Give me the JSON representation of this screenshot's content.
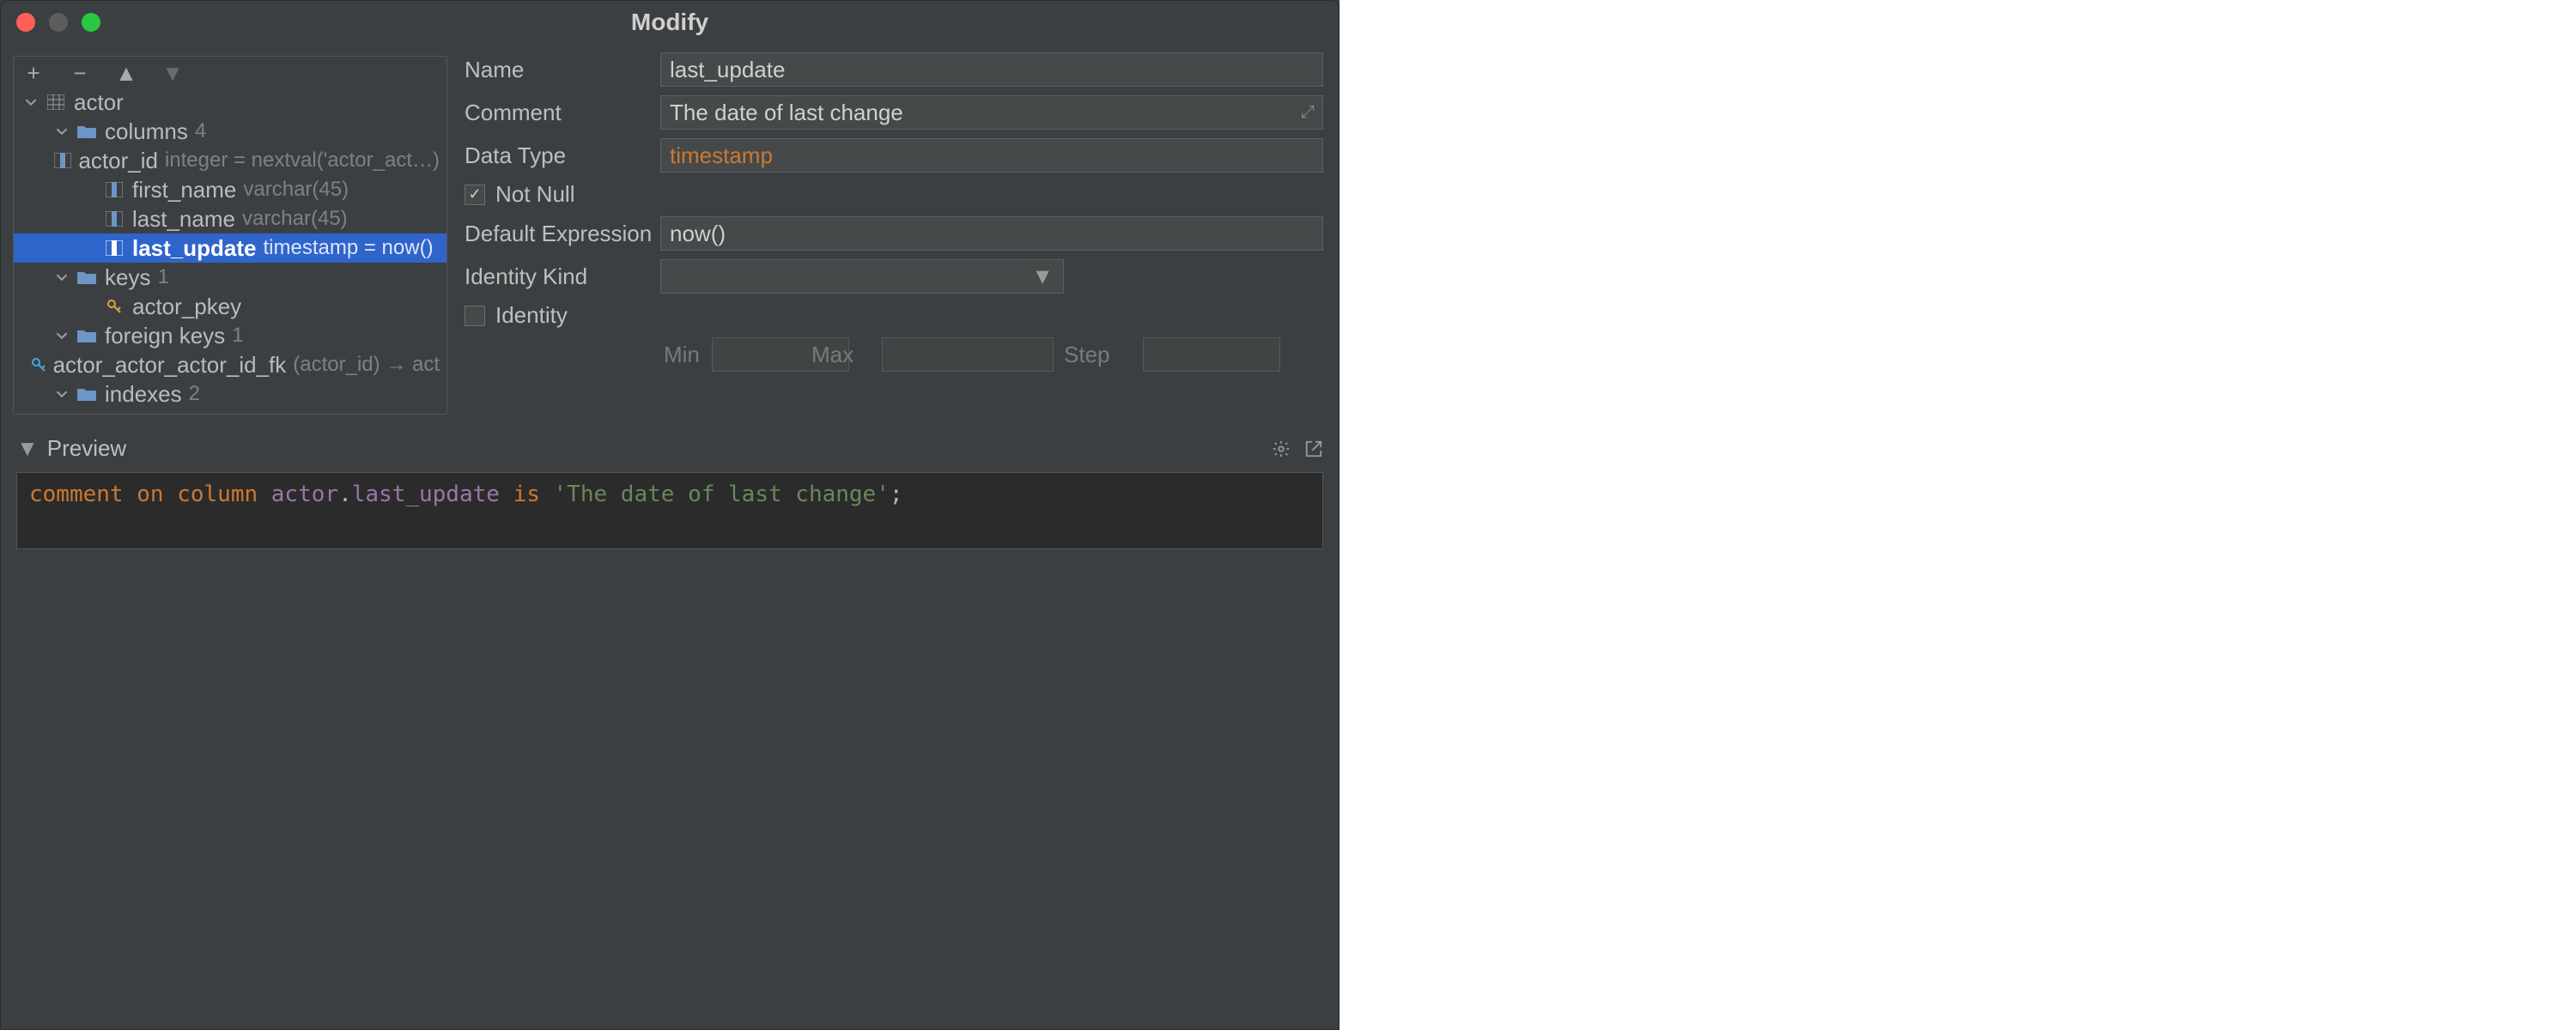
{
  "window": {
    "title": "Modify"
  },
  "toolbar": {
    "add": "+",
    "remove": "−",
    "up": "▲",
    "down": "▼"
  },
  "tree": {
    "root": {
      "name": "actor"
    },
    "columns": {
      "label": "columns",
      "count": "4",
      "items": [
        {
          "name": "actor_id",
          "type": "integer = nextval('actor_act…)"
        },
        {
          "name": "first_name",
          "type": "varchar(45)"
        },
        {
          "name": "last_name",
          "type": "varchar(45)"
        },
        {
          "name": "last_update",
          "type": "timestamp = now()"
        }
      ]
    },
    "keys": {
      "label": "keys",
      "count": "1",
      "items": [
        {
          "name": "actor_pkey"
        }
      ]
    },
    "fkeys": {
      "label": "foreign keys",
      "count": "1",
      "items": [
        {
          "name": "actor_actor_actor_id_fk",
          "detail": "(actor_id) → act"
        }
      ]
    },
    "indexes": {
      "label": "indexes",
      "count": "2"
    }
  },
  "form": {
    "name_label": "Name",
    "name_value": "last_update",
    "comment_label": "Comment",
    "comment_value": "The date of last change",
    "datatype_label": "Data Type",
    "datatype_value": "timestamp",
    "notnull_label": "Not Null",
    "notnull_checked": true,
    "default_label": "Default Expression",
    "default_value": "now()",
    "identity_kind_label": "Identity Kind",
    "identity_kind_value": "",
    "identity_label": "Identity",
    "identity_checked": false,
    "min_label": "Min",
    "min_value": "",
    "max_label": "Max",
    "max_value": "",
    "step_label": "Step",
    "step_value": ""
  },
  "preview": {
    "label": "Preview",
    "sql": {
      "kw1": "comment",
      "kw2": "on",
      "kw3": "column",
      "tbl": "actor",
      "dot": ".",
      "col": "last_update",
      "is": "is",
      "str": "'The date of last change'",
      "semi": ";"
    }
  }
}
